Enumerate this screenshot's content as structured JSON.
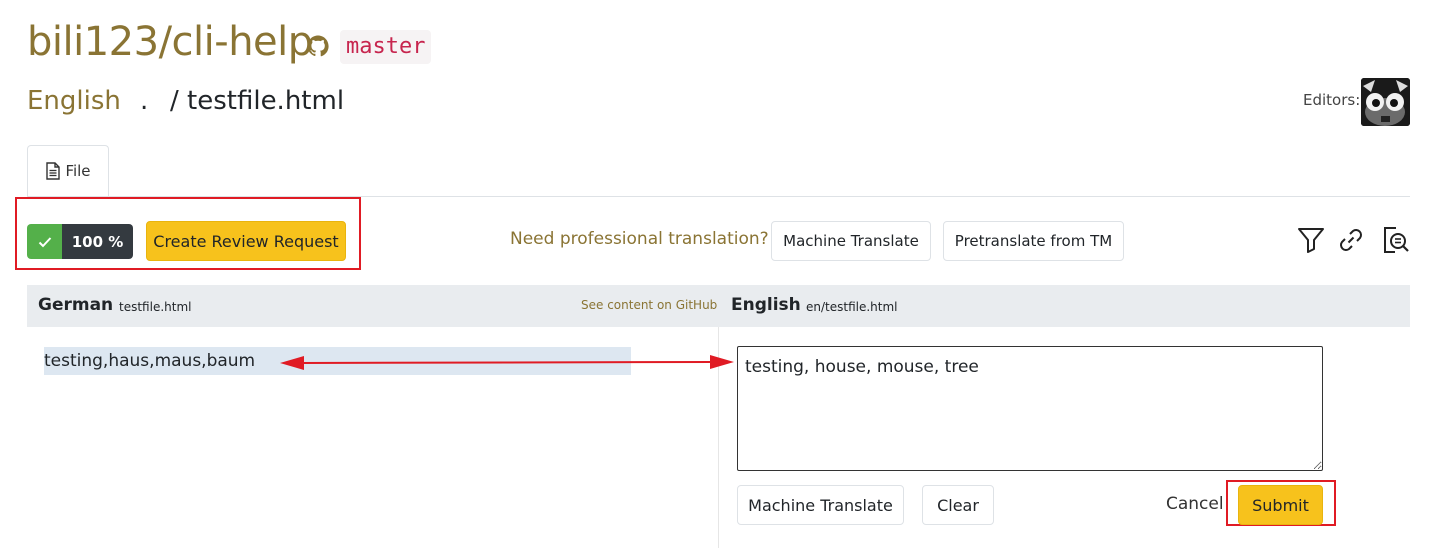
{
  "header": {
    "repo": "bili123/cli-help",
    "branch": "master",
    "language": "English",
    "path_prefix": ".",
    "path_sep": "/",
    "filename": "testfile.html",
    "editors_label": "Editors:"
  },
  "tabs": [
    {
      "label": "File",
      "icon": "file-text-icon",
      "active": true
    }
  ],
  "toolbar": {
    "progress_value": "100 %",
    "progress_status_icon": "checkmark-icon",
    "create_review_label": "Create Review Request",
    "need_pro_text": "Need professional translation?",
    "machine_translate_label": "Machine Translate",
    "pretranslate_label": "Pretranslate from TM",
    "icons": [
      "filter-icon",
      "link-icon",
      "search-review-icon"
    ]
  },
  "source": {
    "language": "German",
    "file": "testfile.html",
    "github_link": "See content on GitHub",
    "text": "testing,haus,maus,baum"
  },
  "target": {
    "language": "English",
    "file": "en/testfile.html",
    "text": "testing, house, mouse, tree",
    "machine_translate_label": "Machine Translate",
    "clear_label": "Clear",
    "cancel_label": "Cancel",
    "submit_label": "Submit"
  },
  "colors": {
    "brand": "#8a7434",
    "accent_yellow": "#f7c21c",
    "success_green": "#54b04a",
    "highlight_red": "#e01b24",
    "branch_code": "#c7254e"
  }
}
